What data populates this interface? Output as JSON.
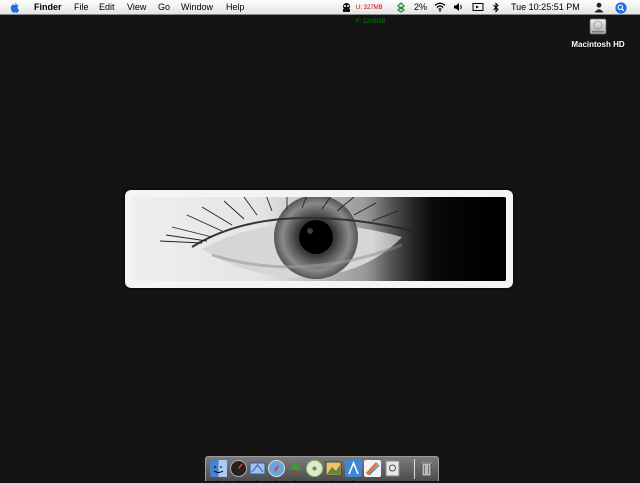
{
  "menubar": {
    "app_name": "Finder",
    "menus": [
      "File",
      "Edit",
      "View",
      "Go",
      "Window",
      "Help"
    ],
    "memory": {
      "used": "U: 327MB",
      "free": "F: 1209MB"
    },
    "battery": "2%",
    "clock": "Tue 10:25:51 PM",
    "icons": [
      "apple-icon",
      "memory-monitor-icon",
      "tracker-icon",
      "wifi-icon",
      "volume-icon",
      "display-mirror-icon",
      "bluetooth-icon",
      "user-icon",
      "spotlight-icon"
    ]
  },
  "desktop": {
    "icons": [
      {
        "label": "Macintosh HD",
        "icon": "hard-drive-icon"
      }
    ]
  },
  "dock": {
    "items": [
      {
        "name": "finder",
        "color": "#4a7fd6",
        "running": true
      },
      {
        "name": "dashboard",
        "color": "#2b2b2b",
        "running": true
      },
      {
        "name": "mail",
        "color": "#6fa0d8",
        "running": true
      },
      {
        "name": "safari",
        "color": "#6aa3e0",
        "running": true
      },
      {
        "name": "utility-app",
        "color": "#5ba84a",
        "running": true
      },
      {
        "name": "itunes",
        "color": "#8fc46a",
        "running": false
      },
      {
        "name": "iphoto",
        "color": "#d9a24a",
        "running": true
      },
      {
        "name": "text-editor",
        "color": "#3c88d6",
        "running": true
      },
      {
        "name": "drawing-app",
        "color": "#e07038",
        "running": false
      },
      {
        "name": "preview",
        "color": "#cfcfcf",
        "running": true
      },
      {
        "name": "trash",
        "color": "#9a9a9a",
        "running": false
      }
    ]
  }
}
